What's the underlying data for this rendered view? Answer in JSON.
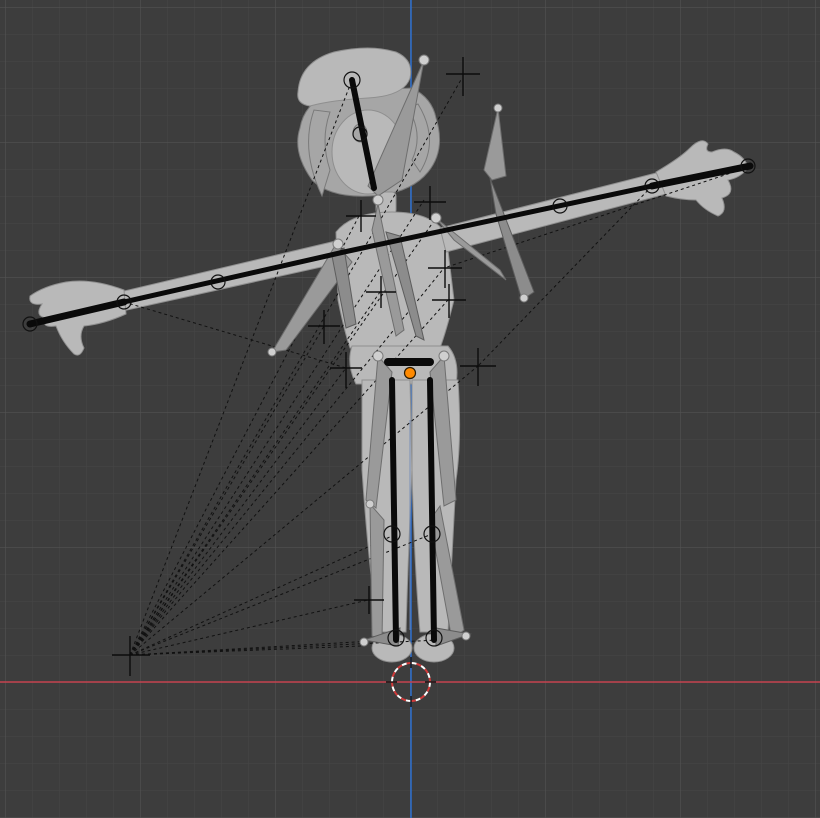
{
  "viewport": {
    "background_color": "#3d3d3d",
    "grid_minor_color": "#444444",
    "grid_major_color": "#4e4e4e",
    "axis_x_color": "#c5424e",
    "axis_z_color": "#2c6fd0",
    "mesh_color": "#b9b9b9",
    "bone_color": "#9a9a9a",
    "active_origin_color": "#ff8a00",
    "cursor_ring_color": "#d23a3a"
  },
  "scene": {
    "object": "character-mesh",
    "armature": "armature",
    "cursor": "3d-cursor-icon",
    "origin": "origin-dot-icon"
  }
}
